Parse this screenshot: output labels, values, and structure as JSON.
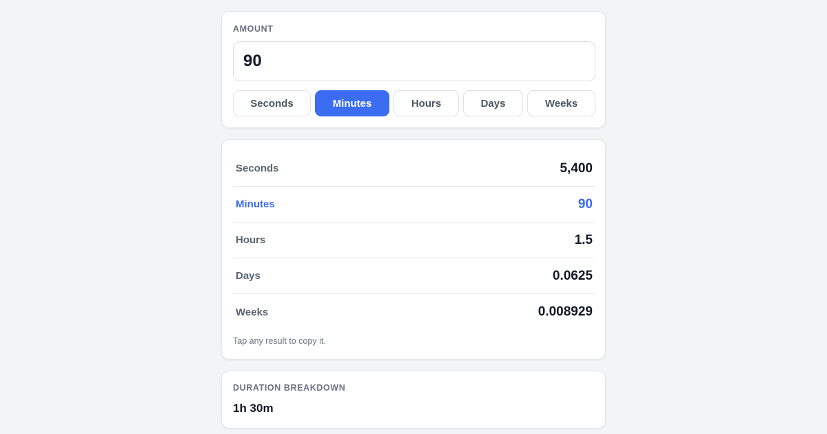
{
  "amount": {
    "label": "AMOUNT",
    "value": "90"
  },
  "units": [
    {
      "label": "Seconds",
      "active": false
    },
    {
      "label": "Minutes",
      "active": true
    },
    {
      "label": "Hours",
      "active": false
    },
    {
      "label": "Days",
      "active": false
    },
    {
      "label": "Weeks",
      "active": false
    }
  ],
  "results": [
    {
      "label": "Seconds",
      "value": "5,400"
    },
    {
      "label": "Minutes",
      "value": "90"
    },
    {
      "label": "Hours",
      "value": "1.5"
    },
    {
      "label": "Days",
      "value": "0.0625"
    },
    {
      "label": "Weeks",
      "value": "0.008929"
    }
  ],
  "hint": "Tap any result to copy it.",
  "breakdown": {
    "label": "DURATION BREAKDOWN",
    "value": "1h 30m"
  },
  "colors": {
    "accent": "#3b6cf2",
    "background": "#f3f4f6",
    "muted_text": "#6b7280"
  }
}
